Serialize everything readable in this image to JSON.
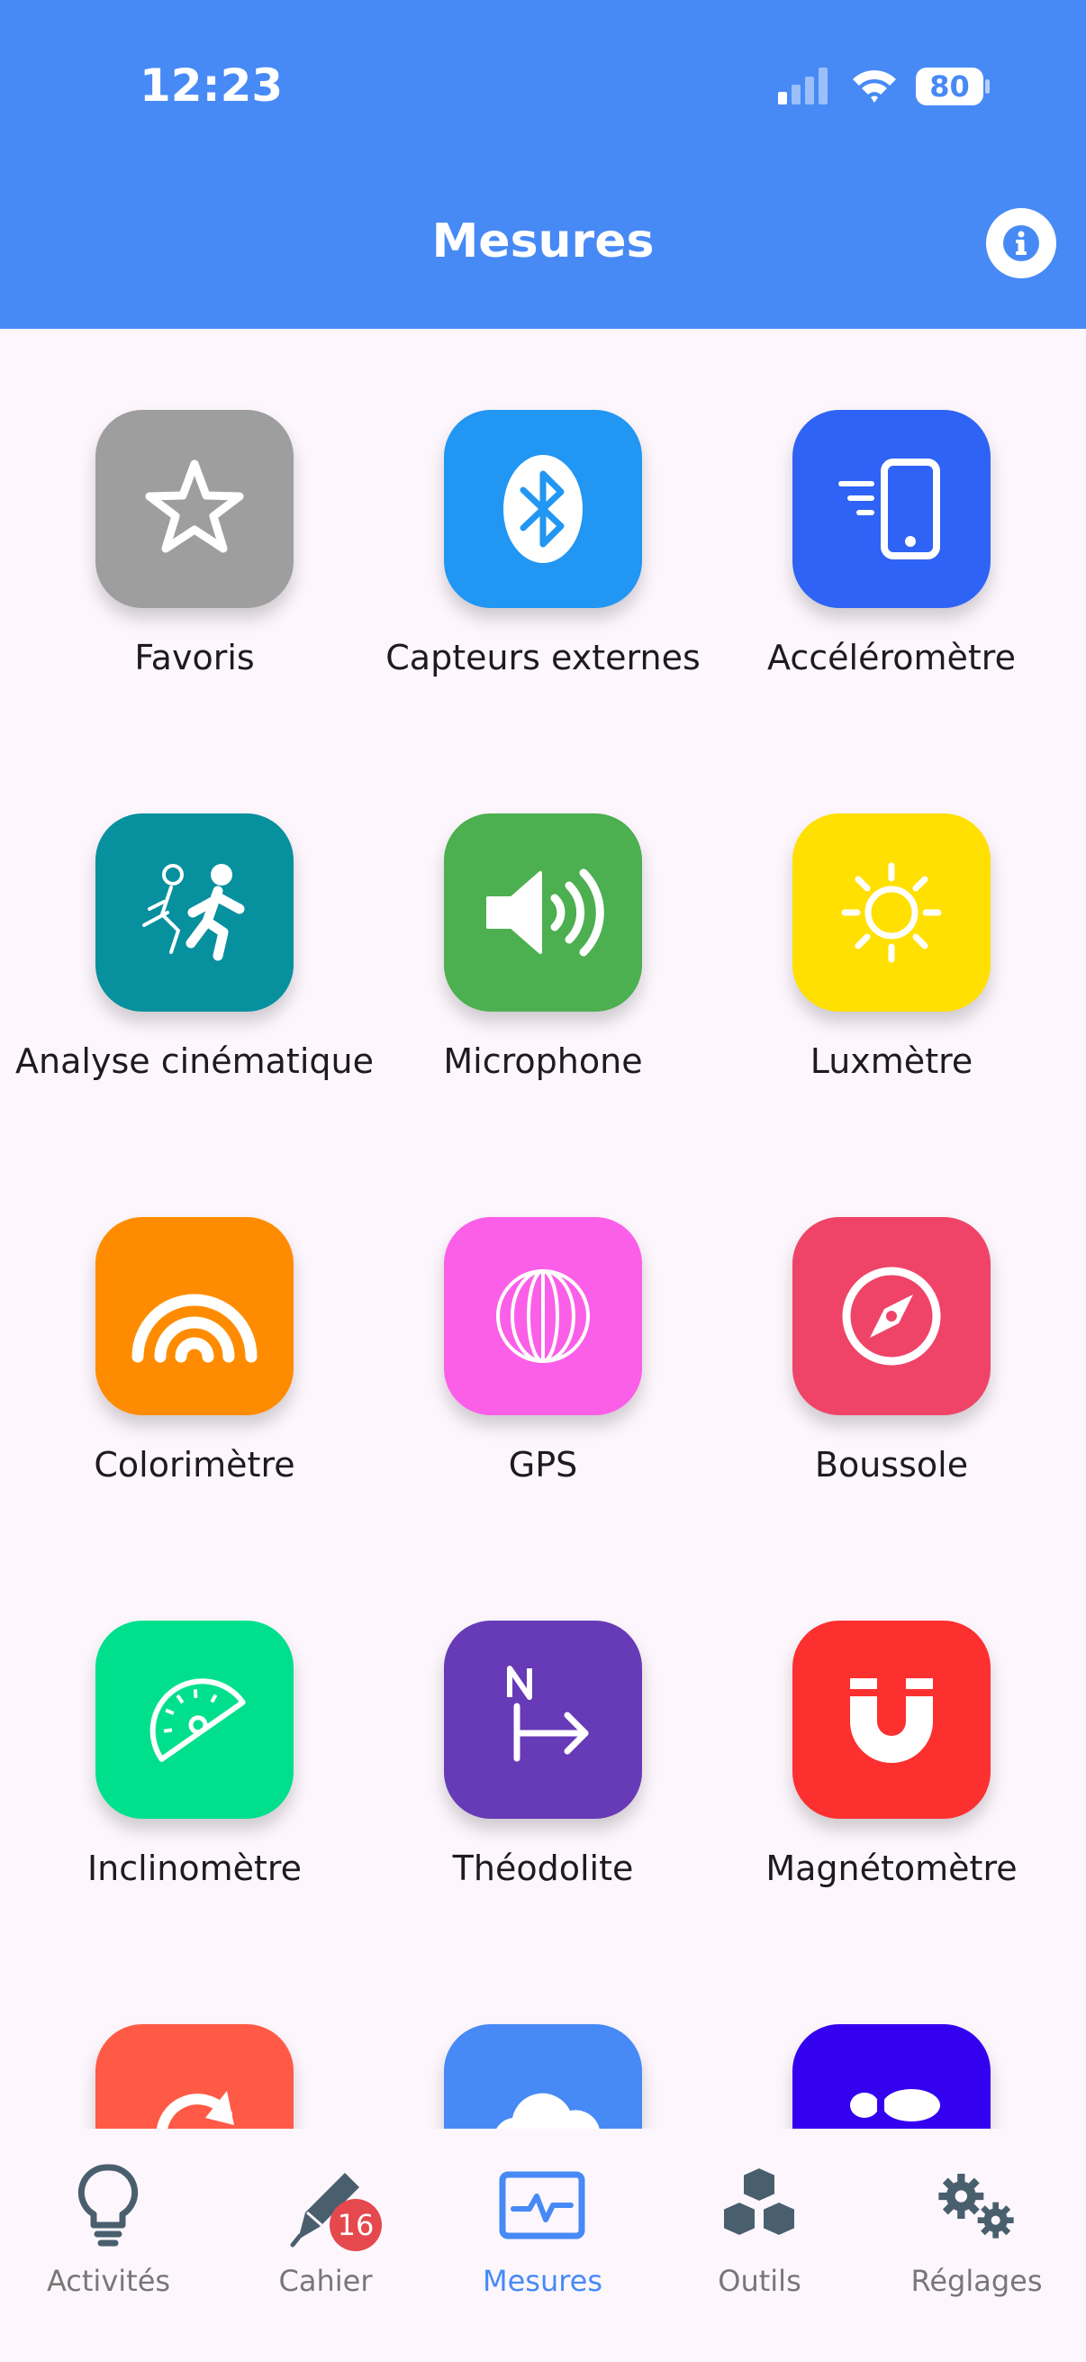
{
  "status_bar": {
    "time": "12:23",
    "battery": "80"
  },
  "header": {
    "title": "Mesures"
  },
  "tiles": [
    {
      "label": "Favoris",
      "icon": "star-icon",
      "color": "#9e9e9e"
    },
    {
      "label": "Capteurs externes",
      "icon": "bluetooth-icon",
      "color": "#2196f3"
    },
    {
      "label": "Accéléromètre",
      "icon": "phone-motion-icon",
      "color": "#2f63f5"
    },
    {
      "label": "Analyse cinématique",
      "icon": "running-people-icon",
      "color": "#07909e"
    },
    {
      "label": "Microphone",
      "icon": "speaker-icon",
      "color": "#4caf50"
    },
    {
      "label": "Luxmètre",
      "icon": "sun-icon",
      "color": "#ffe000"
    },
    {
      "label": "Colorimètre",
      "icon": "rainbow-icon",
      "color": "#ff8c00"
    },
    {
      "label": "GPS",
      "icon": "globe-icon",
      "color": "#fb5fe8"
    },
    {
      "label": "Boussole",
      "icon": "compass-icon",
      "color": "#ef4468"
    },
    {
      "label": "Inclinomètre",
      "icon": "protractor-icon",
      "color": "#00e08c"
    },
    {
      "label": "Théodolite",
      "icon": "north-arrow-icon",
      "color": "#673ab7"
    },
    {
      "label": "Magnétomètre",
      "icon": "magnet-icon",
      "color": "#fd3030"
    },
    {
      "label": "",
      "icon": "rotate-icon",
      "color": "#ff5a46"
    },
    {
      "label": "",
      "icon": "cloud-icon",
      "color": "#478af5"
    },
    {
      "label": "",
      "icon": "footprint-icon",
      "color": "#3400f0"
    }
  ],
  "tabbar": {
    "tabs": [
      {
        "label": "Activités",
        "icon": "lightbulb-icon"
      },
      {
        "label": "Cahier",
        "icon": "pen-icon",
        "badge": "16"
      },
      {
        "label": "Mesures",
        "icon": "pulse-monitor-icon",
        "active": true
      },
      {
        "label": "Outils",
        "icon": "cubes-icon"
      },
      {
        "label": "Réglages",
        "icon": "gears-icon"
      }
    ]
  }
}
